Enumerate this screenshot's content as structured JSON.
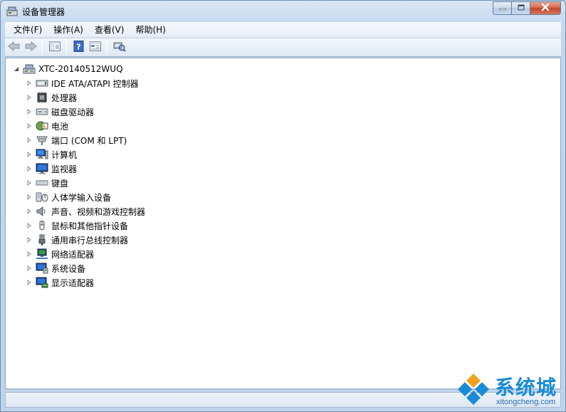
{
  "window": {
    "title": "设备管理器"
  },
  "menu": [
    {
      "label": "文件(F)"
    },
    {
      "label": "操作(A)"
    },
    {
      "label": "查看(V)"
    },
    {
      "label": "帮助(H)"
    }
  ],
  "toolbar": {
    "buttons": [
      "back-icon",
      "forward-icon",
      "show-hide-tree-icon",
      "help-icon",
      "properties-icon",
      "scan-hardware-icon"
    ]
  },
  "tree": {
    "root_label": "XTC-20140512WUQ",
    "items": [
      {
        "label": "IDE ATA/ATAPI 控制器",
        "icon": "ide-controller-icon"
      },
      {
        "label": "处理器",
        "icon": "processor-icon"
      },
      {
        "label": "磁盘驱动器",
        "icon": "disk-drive-icon"
      },
      {
        "label": "电池",
        "icon": "battery-icon"
      },
      {
        "label": "端口 (COM 和 LPT)",
        "icon": "port-icon"
      },
      {
        "label": "计算机",
        "icon": "computer-icon"
      },
      {
        "label": "监视器",
        "icon": "monitor-icon"
      },
      {
        "label": "键盘",
        "icon": "keyboard-icon"
      },
      {
        "label": "人体学输入设备",
        "icon": "hid-icon"
      },
      {
        "label": "声音、视频和游戏控制器",
        "icon": "sound-icon"
      },
      {
        "label": "鼠标和其他指针设备",
        "icon": "mouse-icon"
      },
      {
        "label": "通用串行总线控制器",
        "icon": "usb-icon"
      },
      {
        "label": "网络适配器",
        "icon": "network-adapter-icon"
      },
      {
        "label": "系统设备",
        "icon": "system-device-icon"
      },
      {
        "label": "显示适配器",
        "icon": "display-adapter-icon"
      }
    ]
  },
  "watermark": {
    "brand": "系统城",
    "url": "xitongcheng.com"
  },
  "colors": {
    "frame": "#c2d6ec",
    "tree_background": "#ffffff",
    "watermark_blue": "#1a8bd6"
  }
}
